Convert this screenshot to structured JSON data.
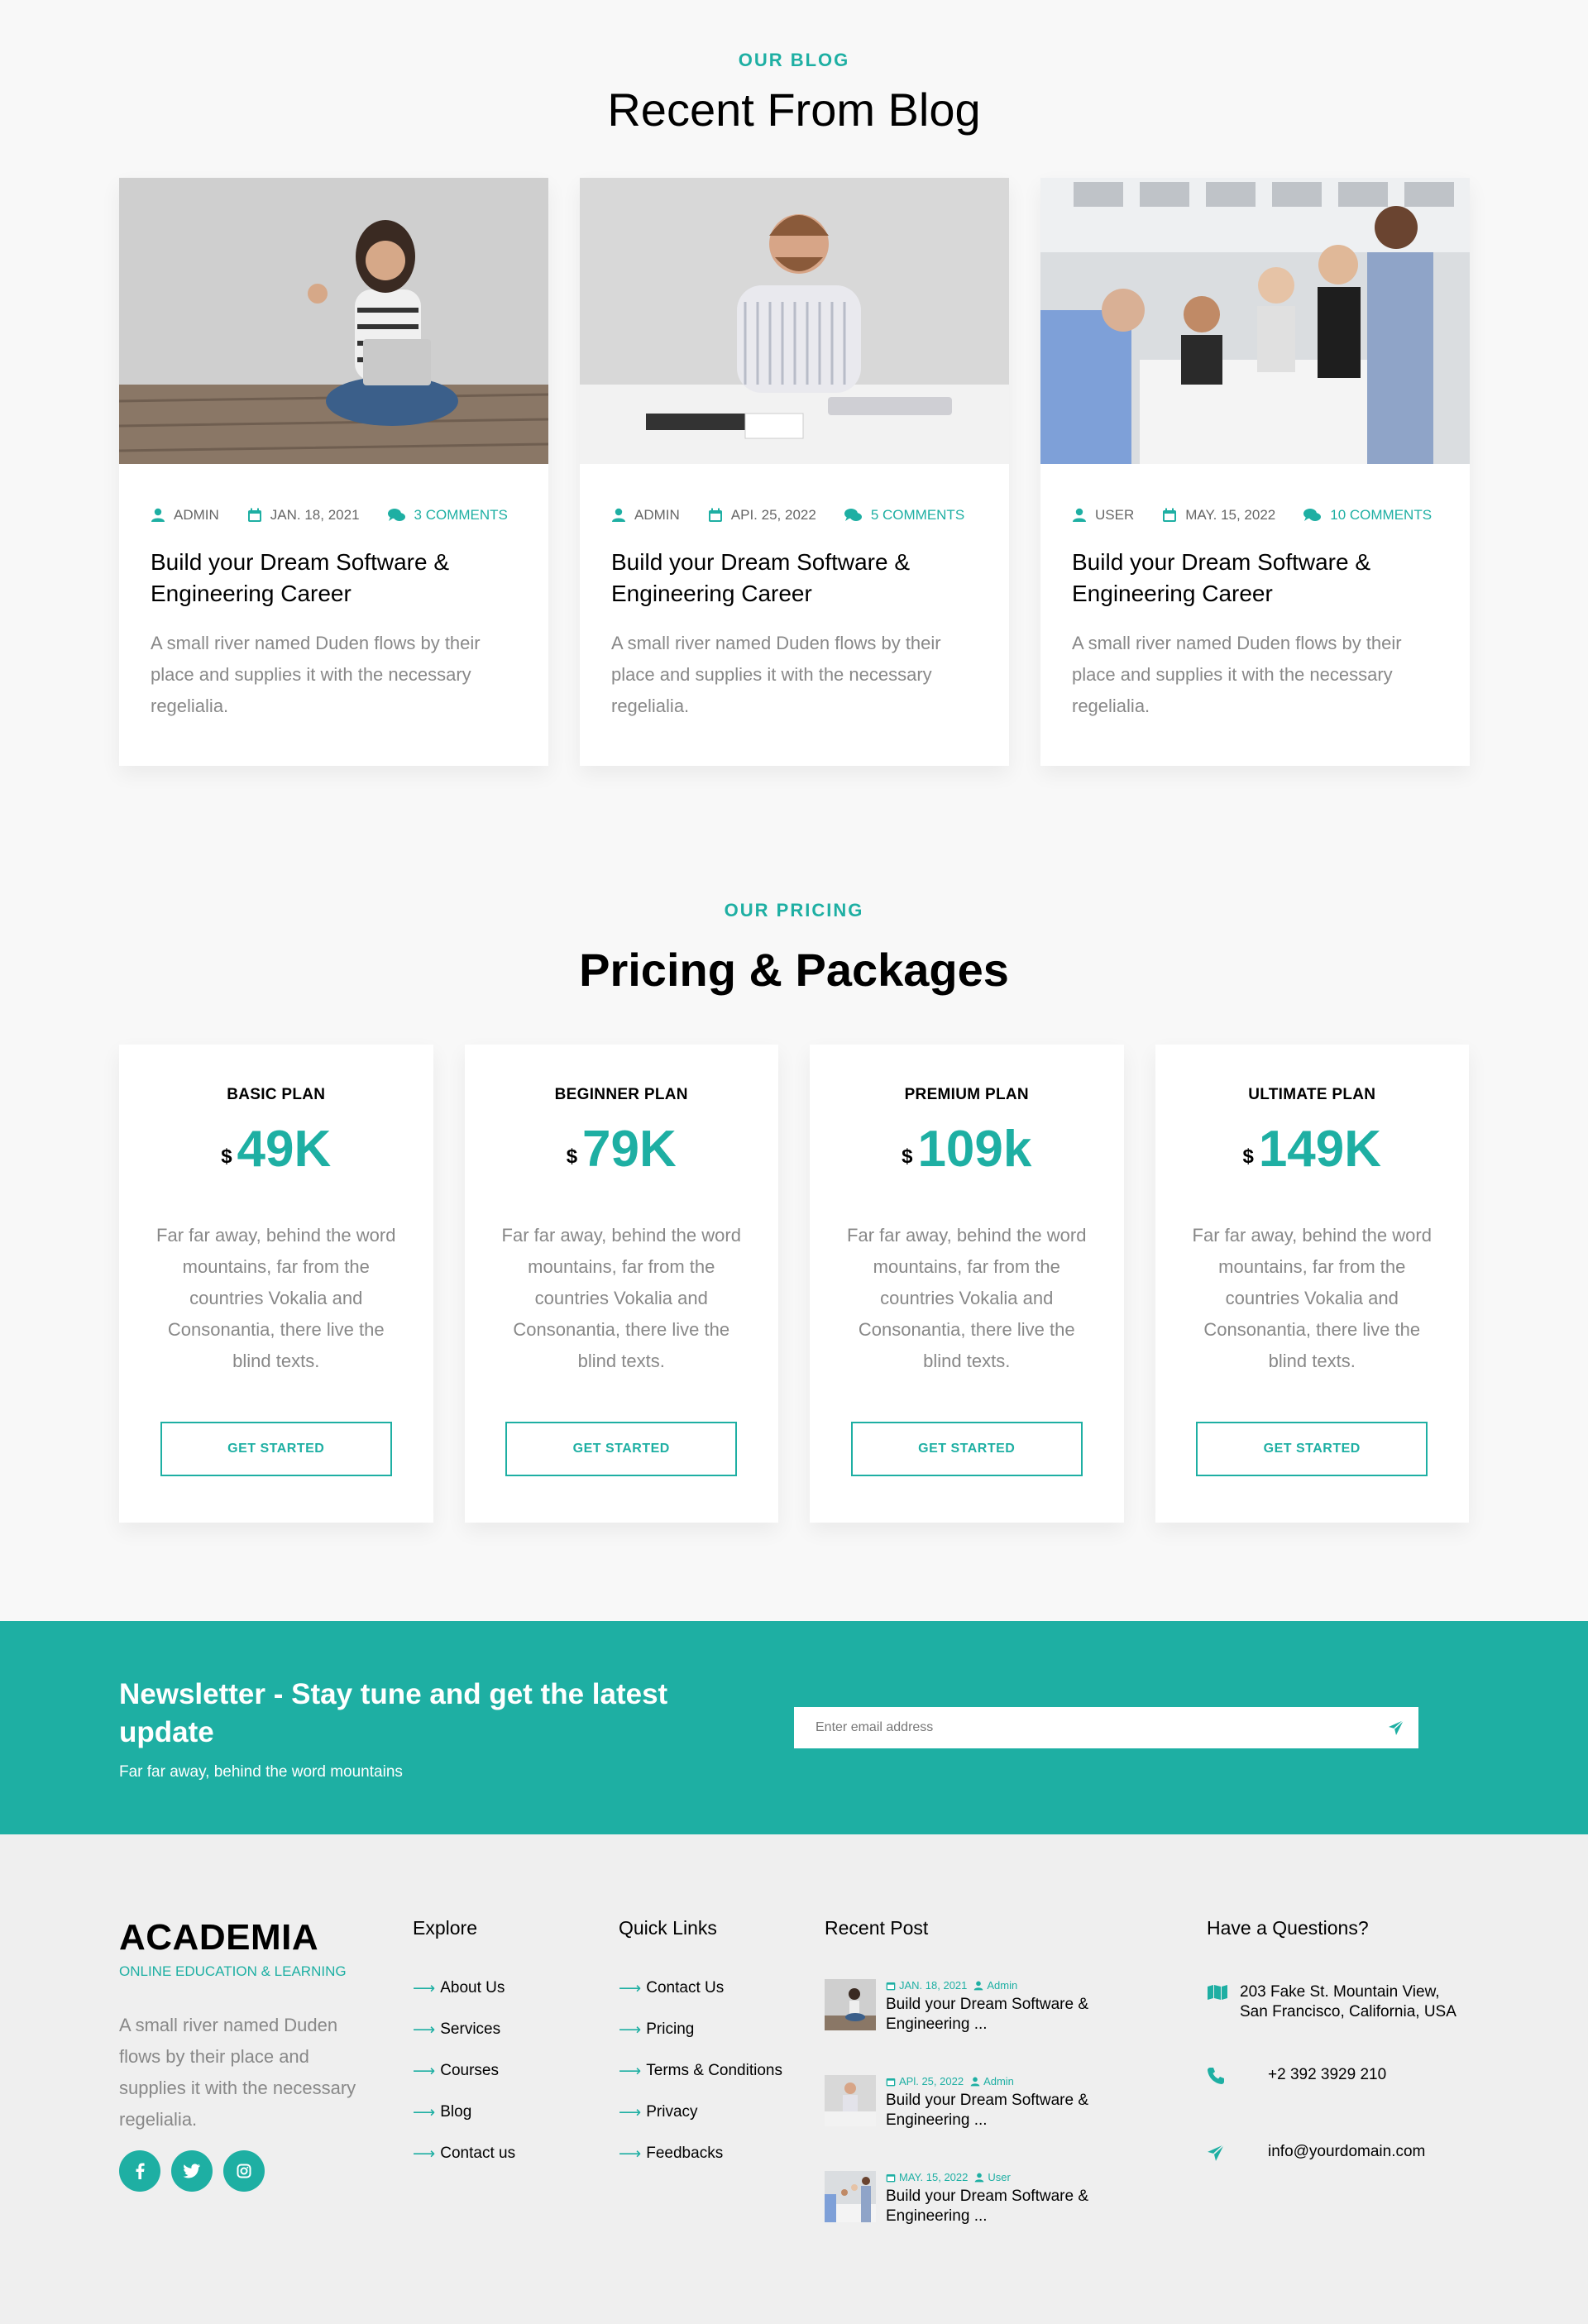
{
  "blog": {
    "eyebrow": "OUR BLOG",
    "title": "Recent From Blog",
    "posts": [
      {
        "author": "ADMIN",
        "date": "JAN. 18, 2021",
        "comments": "3 COMMENTS",
        "title": "Build your Dream Software & Engineering Career",
        "excerpt": "A small river named Duden flows by their place and supplies it with the necessary regelialia."
      },
      {
        "author": "ADMIN",
        "date": "API. 25, 2022",
        "comments": "5 COMMENTS",
        "title": "Build your Dream Software & Engineering Career",
        "excerpt": "A small river named Duden flows by their place and supplies it with the necessary regelialia."
      },
      {
        "author": "USER",
        "date": "MAY. 15, 2022",
        "comments": "10 COMMENTS",
        "title": "Build your Dream Software & Engineering Career",
        "excerpt": "A small river named Duden flows by their place and supplies it with the necessary regelialia."
      }
    ]
  },
  "pricing": {
    "eyebrow": "OUR PRICING",
    "title": "Pricing & Packages",
    "plans": [
      {
        "name": "BASIC PLAN",
        "currency": "$",
        "price": "49K",
        "text": "Far far away, behind the word mountains, far from the countries Vokalia and Consonantia, there live the blind texts.",
        "button": "GET STARTED"
      },
      {
        "name": "BEGINNER PLAN",
        "currency": "$",
        "price": "79K",
        "text": "Far far away, behind the word mountains, far from the countries Vokalia and Consonantia, there live the blind texts.",
        "button": "GET STARTED"
      },
      {
        "name": "PREMIUM PLAN",
        "currency": "$",
        "price": "109k",
        "text": "Far far away, behind the word mountains, far from the countries Vokalia and Consonantia, there live the blind texts.",
        "button": "GET STARTED"
      },
      {
        "name": "ULTIMATE PLAN",
        "currency": "$",
        "price": "149K",
        "text": "Far far away, behind the word mountains, far from the countries Vokalia and Consonantia, there live the blind texts.",
        "button": "GET STARTED"
      }
    ]
  },
  "newsletter": {
    "title": "Newsletter - Stay tune and get the latest update",
    "subtitle": "Far far away, behind the word mountains",
    "placeholder": "Enter email address"
  },
  "footer": {
    "logo": "ACADEMIA",
    "tagline": "ONLINE EDUCATION & LEARNING",
    "about": "A small river named Duden flows by their place and supplies it with the necessary regelialia.",
    "socials": [
      "facebook-icon",
      "twitter-icon",
      "instagram-icon"
    ],
    "explore": {
      "heading": "Explore",
      "links": [
        "About Us",
        "Services",
        "Courses",
        "Blog",
        "Contact us"
      ]
    },
    "quick_links": {
      "heading": "Quick Links",
      "links": [
        "Contact Us",
        "Pricing",
        "Terms & Conditions",
        "Privacy",
        "Feedbacks"
      ]
    },
    "recent_posts": {
      "heading": "Recent Post",
      "posts": [
        {
          "date": "JAN. 18, 2021",
          "author": "Admin",
          "title": "Build your Dream Software & Engineering ..."
        },
        {
          "date": "APl. 25, 2022",
          "author": "Admin",
          "title": "Build your Dream Software & Engineering ..."
        },
        {
          "date": "MAY. 15, 2022",
          "author": "User",
          "title": "Build your Dream Software & Engineering ..."
        }
      ]
    },
    "contact": {
      "heading": "Have a Questions?",
      "address": "203 Fake St. Mountain View, San Francisco, California, USA",
      "phone": "+2 392 3929 210",
      "email": "info@yourdomain.com"
    }
  },
  "colors": {
    "accent": "#1eafa3",
    "background": "#f8f8f8",
    "footer": "#efefef"
  }
}
